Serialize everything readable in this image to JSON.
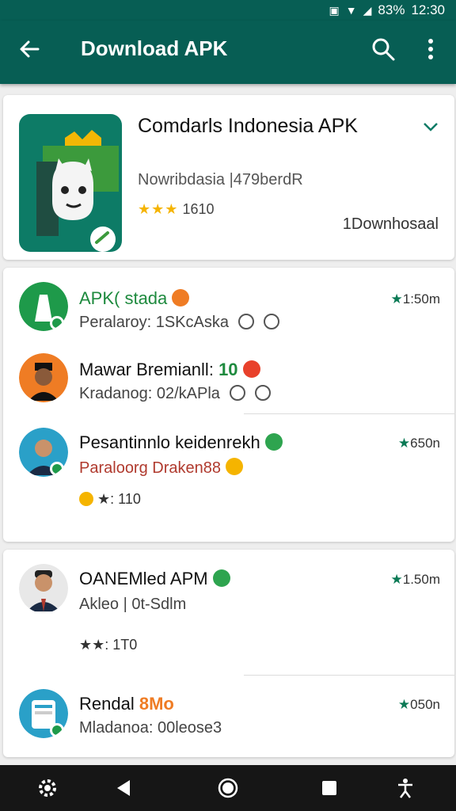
{
  "status_bar": {
    "battery": "83%",
    "time": "12:30"
  },
  "app_bar": {
    "title": "Download APK"
  },
  "app_card": {
    "name": "Comdarls Indonesia APK",
    "developer": "Nowribdasia |479berdR",
    "stars": "★★★",
    "rating": "1610",
    "download_label": "1Downhosaal"
  },
  "list1": [
    {
      "name": "APK( stada",
      "subtitle": "Peralaroy: 1SKcAska",
      "time": "1:50m",
      "time_star": "★"
    },
    {
      "name": "Mawar Bremianll:",
      "name_accent": "10",
      "subtitle": "Kradanog: 02/kAPla"
    },
    {
      "name": "Pesantinnlo keidenrekh",
      "subtitle": "Paraloorg Draken88",
      "time": "650n",
      "time_star": "★",
      "meta_stars": "★:",
      "meta": "110"
    }
  ],
  "list2": [
    {
      "name": "OANEMled APM",
      "subtitle": "Akleo | 0t-Sdlm",
      "time": "1.50m",
      "time_star": "★",
      "meta_stars": "★★:",
      "meta": "1T0"
    },
    {
      "name": "Rendal",
      "name_accent": "8Mo",
      "subtitle": "Mladanoa: 00leose3",
      "time": "050n",
      "time_star": "★"
    }
  ],
  "colors": {
    "primary": "#075e54",
    "accent_green": "#0b7a55",
    "star_yellow": "#f5b400",
    "verified": "#2ea44f",
    "orange": "#ef7c24"
  },
  "icons": [
    "back-arrow-icon",
    "search-icon",
    "more-vert-icon",
    "chevron-down-icon",
    "settings-icon",
    "back-triangle-icon",
    "home-circle-icon",
    "recents-square-icon",
    "accessibility-icon"
  ]
}
